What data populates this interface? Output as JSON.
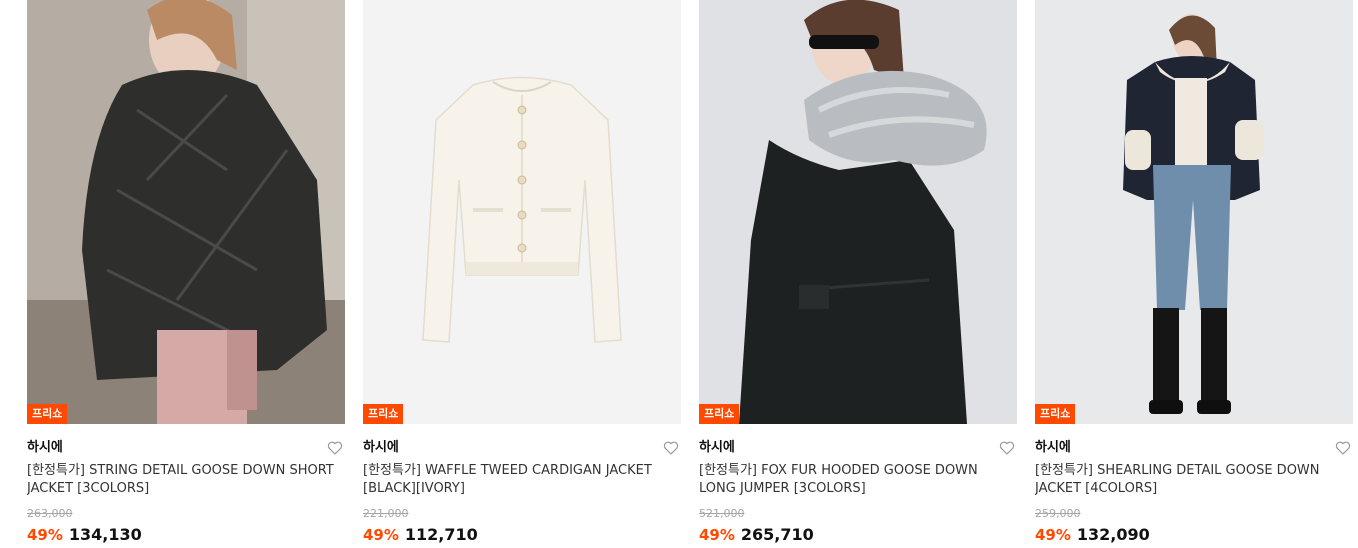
{
  "products": [
    {
      "badge": "프리쇼",
      "brand": "하시에",
      "name": "[한정특가] STRING DETAIL GOOSE DOWN SHORT JACKET [3COLORS]",
      "original_price": "263,000",
      "discount": "49%",
      "price": "134,130",
      "icon": "heart-outline-icon"
    },
    {
      "badge": "프리쇼",
      "brand": "하시에",
      "name": "[한정특가] WAFFLE TWEED CARDIGAN JACKET [BLACK][IVORY]",
      "original_price": "221,000",
      "discount": "49%",
      "price": "112,710",
      "icon": "heart-outline-icon"
    },
    {
      "badge": "프리쇼",
      "brand": "하시에",
      "name": "[한정특가] FOX FUR HOODED GOOSE DOWN LONG JUMPER [3COLORS]",
      "original_price": "521,000",
      "discount": "49%",
      "price": "265,710",
      "icon": "heart-outline-icon"
    },
    {
      "badge": "프리쇼",
      "brand": "하시에",
      "name": "[한정특가] SHEARLING DETAIL GOOSE DOWN JACKET [4COLORS]",
      "original_price": "259,000",
      "discount": "49%",
      "price": "132,090",
      "icon": "heart-outline-icon"
    }
  ],
  "colors": {
    "accent": "#ff4800",
    "strike": "#a6a6a6"
  }
}
